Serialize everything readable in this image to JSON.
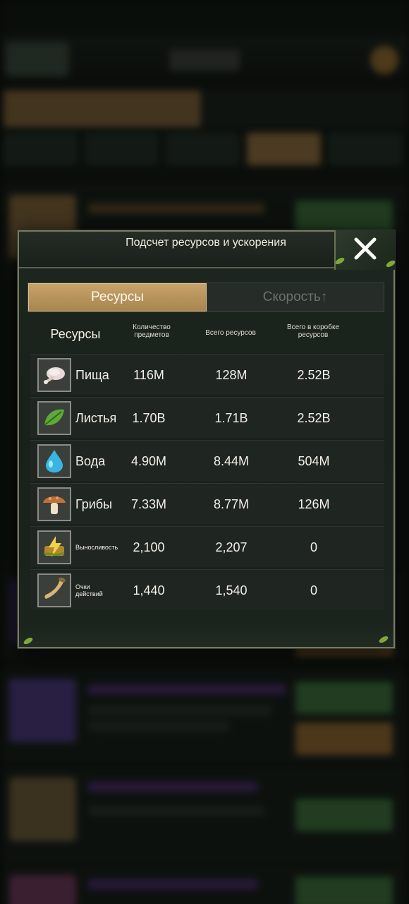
{
  "dialog": {
    "title": "Подсчет ресурсов и ускорения",
    "close_icon": "close-x-icon"
  },
  "tabs": [
    {
      "label": "Ресурсы",
      "active": true
    },
    {
      "label": "Скорость↑",
      "active": false
    }
  ],
  "columns": {
    "name": "Ресурсы",
    "items": "Количество предметов",
    "total": "Всего ресурсов",
    "box_total": "Всего в коробке ресурсов"
  },
  "rows": [
    {
      "icon": "meat-icon",
      "name": "Пища",
      "items": "116M",
      "total": "128M",
      "box_total": "2.52B"
    },
    {
      "icon": "leaf-icon",
      "name": "Листья",
      "items": "1.70B",
      "total": "1.71B",
      "box_total": "2.52B"
    },
    {
      "icon": "water-drop-icon",
      "name": "Вода",
      "items": "4.90M",
      "total": "8.44M",
      "box_total": "504M"
    },
    {
      "icon": "mushroom-icon",
      "name": "Грибы",
      "items": "7.33M",
      "total": "8.77M",
      "box_total": "126M"
    },
    {
      "icon": "stamina-icon",
      "name": "Выносливость",
      "items": "2,100",
      "total": "2,207",
      "box_total": "0"
    },
    {
      "icon": "horn-icon",
      "name": "Очки действий",
      "items": "1,440",
      "total": "1,540",
      "box_total": "0"
    }
  ],
  "colors": {
    "tab_active": "#c8a36a",
    "panel": "#1d2720",
    "border": "#7a7a62"
  }
}
